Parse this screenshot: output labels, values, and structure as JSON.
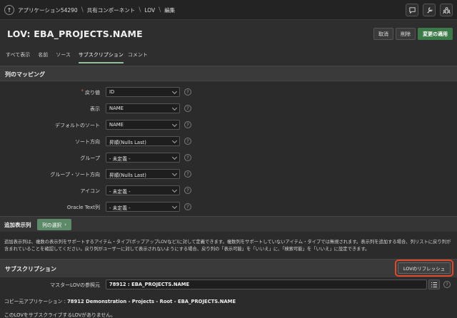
{
  "breadcrumb": {
    "items": [
      "アプリケーション54290",
      "共有コンポーネント",
      "LOV",
      "編集"
    ]
  },
  "toolbar_icons": [
    "comment-icon",
    "wrench-icon",
    "team-icon"
  ],
  "header": {
    "title": "LOV: EBA_PROJECTS.NAME",
    "cancel_label": "取消",
    "delete_label": "削除",
    "apply_label": "変更の適用"
  },
  "tabs": [
    "すべて表示",
    "名前",
    "ソース",
    "サブスクリプション",
    "コメント"
  ],
  "active_tab": "サブスクリプション",
  "column_mapping": {
    "title": "列のマッピング",
    "fields": [
      {
        "label": "戻り値",
        "value": "ID",
        "required": true
      },
      {
        "label": "表示",
        "value": "NAME",
        "required": false
      },
      {
        "label": "デフォルトのソート",
        "value": "NAME",
        "required": false
      },
      {
        "label": "ソート方向",
        "value": "昇順(Nulls Last)",
        "required": false
      },
      {
        "label": "グループ",
        "value": "- 未定義 -",
        "required": false
      },
      {
        "label": "グループ・ソート方向",
        "value": "昇順(Nulls Last)",
        "required": false
      },
      {
        "label": "アイコン",
        "value": "- 未定義 -",
        "required": false
      },
      {
        "label": "Oracle Text列",
        "value": "- 未定義 -",
        "required": false
      }
    ]
  },
  "additional_columns": {
    "title": "追加表示列",
    "button_label": "列の選択",
    "description": "追加表示列は、複数の表示列をサポートするアイテム・タイプ(ポップアップLOVなど)に対して定義できます。複数列をサポートしていないアイテム・タイプでは無視されます。表示列を追加する場合、列リストに戻り列が含まれていることを確認してください。戻り列がユーザーに対して表示されないようにする場合、戻り列の「表示可能」を「いいえ」に、「検索可能」を「いいえ」に設定できます。"
  },
  "subscription": {
    "title": "サブスクリプション",
    "refresh_label": "LOVのリフレッシュ",
    "master_label": "マスターLOVの参照元",
    "master_value": "78912 : EBA_PROJECTS.NAME",
    "copy_source_label": "コピー元アプリケーション :",
    "copy_source_value": "78912 Demonstration - Projects - Root - EBA_PROJECTS.NAME",
    "no_subscribers": "このLOVをサブスクライブするLOVがありません。"
  }
}
